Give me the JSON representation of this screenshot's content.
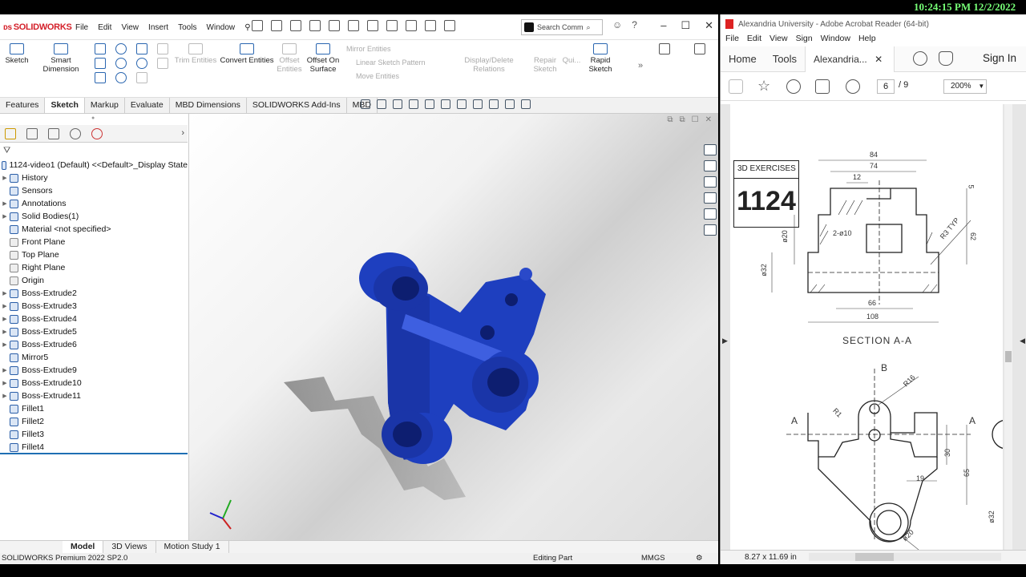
{
  "clock": "10:24:15 PM 12/2/2022",
  "solidworks": {
    "logo": "SOLIDWORKS",
    "menu": [
      "File",
      "Edit",
      "View",
      "Insert",
      "Tools",
      "Window"
    ],
    "search_placeholder": "Search Comm",
    "ribbon": {
      "sketch": "Sketch",
      "smart_dimension": "Smart Dimension",
      "trim_entities": "Trim Entities",
      "convert_entities": "Convert Entities",
      "offset_entities": "Offset Entities",
      "offset_on_surface": "Offset On Surface",
      "mirror_entities": "Mirror Entities",
      "linear_sketch_pattern": "Linear Sketch Pattern",
      "move_entities": "Move Entities",
      "display_delete_relations": "Display/Delete Relations",
      "repair_sketch": "Repair Sketch",
      "quick_snaps": "Qui...",
      "rapid_sketch": "Rapid Sketch"
    },
    "command_tabs": [
      "Features",
      "Sketch",
      "Markup",
      "Evaluate",
      "MBD Dimensions",
      "SOLIDWORKS Add-Ins",
      "MBD"
    ],
    "active_tab": "Sketch",
    "tree": [
      {
        "label": "1124-video1 (Default) <<Default>_Display State",
        "arrow": false,
        "icon": "part-icon"
      },
      {
        "label": "History",
        "arrow": true,
        "icon": "folder-icon"
      },
      {
        "label": "Sensors",
        "arrow": false,
        "icon": "folder-icon"
      },
      {
        "label": "Annotations",
        "arrow": true,
        "icon": "folder-icon"
      },
      {
        "label": "Solid Bodies(1)",
        "arrow": true,
        "icon": "folder-icon"
      },
      {
        "label": "Material <not specified>",
        "arrow": false,
        "icon": "material-icon"
      },
      {
        "label": "Front Plane",
        "arrow": false,
        "icon": "plane-icon"
      },
      {
        "label": "Top Plane",
        "arrow": false,
        "icon": "plane-icon"
      },
      {
        "label": "Right Plane",
        "arrow": false,
        "icon": "plane-icon"
      },
      {
        "label": "Origin",
        "arrow": false,
        "icon": "origin-icon"
      },
      {
        "label": "Boss-Extrude2",
        "arrow": true,
        "icon": "extrude-icon"
      },
      {
        "label": "Boss-Extrude3",
        "arrow": true,
        "icon": "extrude-icon"
      },
      {
        "label": "Boss-Extrude4",
        "arrow": true,
        "icon": "extrude-icon"
      },
      {
        "label": "Boss-Extrude5",
        "arrow": true,
        "icon": "extrude-icon"
      },
      {
        "label": "Boss-Extrude6",
        "arrow": true,
        "icon": "extrude-icon"
      },
      {
        "label": "Mirror5",
        "arrow": false,
        "icon": "mirror-icon"
      },
      {
        "label": "Boss-Extrude9",
        "arrow": true,
        "icon": "extrude-icon"
      },
      {
        "label": "Boss-Extrude10",
        "arrow": true,
        "icon": "extrude-icon"
      },
      {
        "label": "Boss-Extrude11",
        "arrow": true,
        "icon": "extrude-icon"
      },
      {
        "label": "Fillet1",
        "arrow": false,
        "icon": "fillet-icon"
      },
      {
        "label": "Fillet2",
        "arrow": false,
        "icon": "fillet-icon"
      },
      {
        "label": "Fillet3",
        "arrow": false,
        "icon": "fillet-icon"
      },
      {
        "label": "Fillet4",
        "arrow": false,
        "icon": "fillet-icon"
      }
    ],
    "bottom_tabs": [
      "Model",
      "3D Views",
      "Motion Study 1"
    ],
    "status": {
      "product": "SOLIDWORKS Premium 2022 SP2.0",
      "mode": "Editing Part",
      "units": "MMGS"
    },
    "part_color": "#1e3fbf"
  },
  "acrobat": {
    "title": "Alexandria University - Adobe Acrobat Reader (64-bit)",
    "menu": [
      "File",
      "Edit",
      "View",
      "Sign",
      "Window",
      "Help"
    ],
    "tabs": {
      "home": "Home",
      "tools": "Tools",
      "doc": "Alexandria..."
    },
    "sign_in": "Sign In",
    "page_current": "6",
    "page_total": "/ 9",
    "zoom": "200%",
    "page_size": "8.27 x 11.69 in",
    "drawing": {
      "exercise_label": "3D EXERCISES",
      "exercise_number": "1124",
      "section_label": "SECTION A-A",
      "view_label_b": "B",
      "view_label_a": "A",
      "dims": [
        "84",
        "74",
        "12",
        "5",
        "R3 TYP",
        "62",
        "ø20",
        "2-ø10",
        "ø32",
        "66",
        "108",
        "R16",
        "R1",
        "30",
        "65",
        "19",
        "ø20",
        "ø32"
      ]
    }
  }
}
